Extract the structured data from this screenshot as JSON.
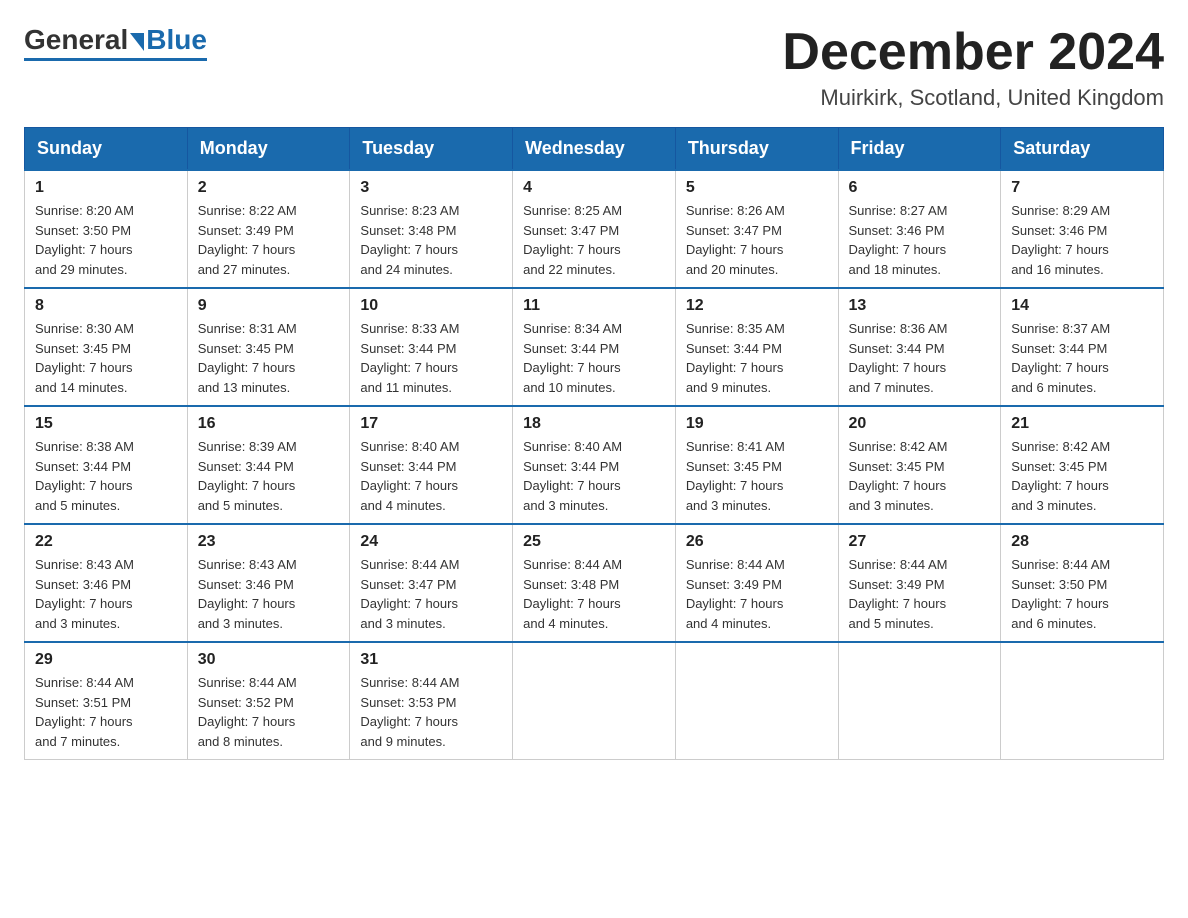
{
  "header": {
    "logo": {
      "general": "General",
      "blue": "Blue"
    },
    "title": "December 2024",
    "location": "Muirkirk, Scotland, United Kingdom"
  },
  "weekdays": [
    "Sunday",
    "Monday",
    "Tuesday",
    "Wednesday",
    "Thursday",
    "Friday",
    "Saturday"
  ],
  "weeks": [
    [
      {
        "day": "1",
        "sunrise": "8:20 AM",
        "sunset": "3:50 PM",
        "daylight": "7 hours and 29 minutes."
      },
      {
        "day": "2",
        "sunrise": "8:22 AM",
        "sunset": "3:49 PM",
        "daylight": "7 hours and 27 minutes."
      },
      {
        "day": "3",
        "sunrise": "8:23 AM",
        "sunset": "3:48 PM",
        "daylight": "7 hours and 24 minutes."
      },
      {
        "day": "4",
        "sunrise": "8:25 AM",
        "sunset": "3:47 PM",
        "daylight": "7 hours and 22 minutes."
      },
      {
        "day": "5",
        "sunrise": "8:26 AM",
        "sunset": "3:47 PM",
        "daylight": "7 hours and 20 minutes."
      },
      {
        "day": "6",
        "sunrise": "8:27 AM",
        "sunset": "3:46 PM",
        "daylight": "7 hours and 18 minutes."
      },
      {
        "day": "7",
        "sunrise": "8:29 AM",
        "sunset": "3:46 PM",
        "daylight": "7 hours and 16 minutes."
      }
    ],
    [
      {
        "day": "8",
        "sunrise": "8:30 AM",
        "sunset": "3:45 PM",
        "daylight": "7 hours and 14 minutes."
      },
      {
        "day": "9",
        "sunrise": "8:31 AM",
        "sunset": "3:45 PM",
        "daylight": "7 hours and 13 minutes."
      },
      {
        "day": "10",
        "sunrise": "8:33 AM",
        "sunset": "3:44 PM",
        "daylight": "7 hours and 11 minutes."
      },
      {
        "day": "11",
        "sunrise": "8:34 AM",
        "sunset": "3:44 PM",
        "daylight": "7 hours and 10 minutes."
      },
      {
        "day": "12",
        "sunrise": "8:35 AM",
        "sunset": "3:44 PM",
        "daylight": "7 hours and 9 minutes."
      },
      {
        "day": "13",
        "sunrise": "8:36 AM",
        "sunset": "3:44 PM",
        "daylight": "7 hours and 7 minutes."
      },
      {
        "day": "14",
        "sunrise": "8:37 AM",
        "sunset": "3:44 PM",
        "daylight": "7 hours and 6 minutes."
      }
    ],
    [
      {
        "day": "15",
        "sunrise": "8:38 AM",
        "sunset": "3:44 PM",
        "daylight": "7 hours and 5 minutes."
      },
      {
        "day": "16",
        "sunrise": "8:39 AM",
        "sunset": "3:44 PM",
        "daylight": "7 hours and 5 minutes."
      },
      {
        "day": "17",
        "sunrise": "8:40 AM",
        "sunset": "3:44 PM",
        "daylight": "7 hours and 4 minutes."
      },
      {
        "day": "18",
        "sunrise": "8:40 AM",
        "sunset": "3:44 PM",
        "daylight": "7 hours and 3 minutes."
      },
      {
        "day": "19",
        "sunrise": "8:41 AM",
        "sunset": "3:45 PM",
        "daylight": "7 hours and 3 minutes."
      },
      {
        "day": "20",
        "sunrise": "8:42 AM",
        "sunset": "3:45 PM",
        "daylight": "7 hours and 3 minutes."
      },
      {
        "day": "21",
        "sunrise": "8:42 AM",
        "sunset": "3:45 PM",
        "daylight": "7 hours and 3 minutes."
      }
    ],
    [
      {
        "day": "22",
        "sunrise": "8:43 AM",
        "sunset": "3:46 PM",
        "daylight": "7 hours and 3 minutes."
      },
      {
        "day": "23",
        "sunrise": "8:43 AM",
        "sunset": "3:46 PM",
        "daylight": "7 hours and 3 minutes."
      },
      {
        "day": "24",
        "sunrise": "8:44 AM",
        "sunset": "3:47 PM",
        "daylight": "7 hours and 3 minutes."
      },
      {
        "day": "25",
        "sunrise": "8:44 AM",
        "sunset": "3:48 PM",
        "daylight": "7 hours and 4 minutes."
      },
      {
        "day": "26",
        "sunrise": "8:44 AM",
        "sunset": "3:49 PM",
        "daylight": "7 hours and 4 minutes."
      },
      {
        "day": "27",
        "sunrise": "8:44 AM",
        "sunset": "3:49 PM",
        "daylight": "7 hours and 5 minutes."
      },
      {
        "day": "28",
        "sunrise": "8:44 AM",
        "sunset": "3:50 PM",
        "daylight": "7 hours and 6 minutes."
      }
    ],
    [
      {
        "day": "29",
        "sunrise": "8:44 AM",
        "sunset": "3:51 PM",
        "daylight": "7 hours and 7 minutes."
      },
      {
        "day": "30",
        "sunrise": "8:44 AM",
        "sunset": "3:52 PM",
        "daylight": "7 hours and 8 minutes."
      },
      {
        "day": "31",
        "sunrise": "8:44 AM",
        "sunset": "3:53 PM",
        "daylight": "7 hours and 9 minutes."
      },
      null,
      null,
      null,
      null
    ]
  ],
  "labels": {
    "sunrise": "Sunrise:",
    "sunset": "Sunset:",
    "daylight": "Daylight:"
  },
  "colors": {
    "header_bg": "#1a6aad",
    "border": "#ccc",
    "text": "#333"
  }
}
